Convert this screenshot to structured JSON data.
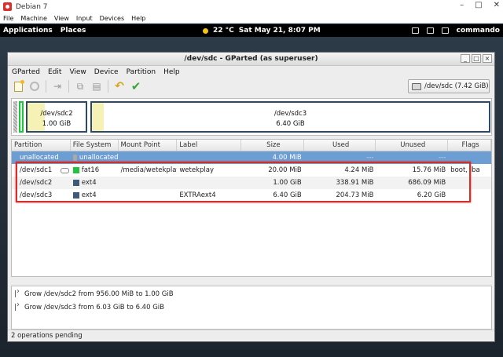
{
  "host": {
    "title": "Debian 7",
    "controls": [
      "–",
      "□",
      "✕"
    ],
    "menu": [
      "File",
      "Machine",
      "View",
      "Input",
      "Devices",
      "Help"
    ]
  },
  "panel": {
    "applications": "Applications",
    "places": "Places",
    "weather": "22 °C",
    "datetime": "Sat May 21,  8:07 PM",
    "user": "commando"
  },
  "gparted": {
    "title": "/dev/sdc - GParted (as superuser)",
    "window_controls": [
      "_",
      "□",
      "×"
    ],
    "menu": [
      "GParted",
      "Edit",
      "View",
      "Device",
      "Partition",
      "Help"
    ],
    "device_select": "/dev/sdc  (7.42 GiB)",
    "map": {
      "sdc2": {
        "name": "/dev/sdc2",
        "size": "1.00 GiB"
      },
      "sdc3": {
        "name": "/dev/sdc3",
        "size": "6.40 GiB"
      }
    },
    "columns": [
      "Partition",
      "File System",
      "Mount Point",
      "Label",
      "Size",
      "Used",
      "Unused",
      "Flags"
    ],
    "rows": [
      {
        "partition": "unallocated",
        "fs": "unallocated",
        "fs_color": "#a9a9a9",
        "mount": "",
        "label": "",
        "size": "4.00 MiB",
        "used": "---",
        "unused": "---",
        "flags": ""
      },
      {
        "partition": "/dev/sdc1",
        "fs": "fat16",
        "fs_color": "#1fc53d",
        "mount": "/media/wetekplay",
        "label": "wetekplay",
        "size": "20.00 MiB",
        "used": "4.24 MiB",
        "unused": "15.76 MiB",
        "flags": "boot, lba"
      },
      {
        "partition": "/dev/sdc2",
        "fs": "ext4",
        "fs_color": "#3d5a7a",
        "mount": "",
        "label": "",
        "size": "1.00 GiB",
        "used": "338.91 MiB",
        "unused": "686.09 MiB",
        "flags": ""
      },
      {
        "partition": "/dev/sdc3",
        "fs": "ext4",
        "fs_color": "#3d5a7a",
        "mount": "",
        "label": "EXTRAext4",
        "size": "6.40 GiB",
        "used": "204.73 MiB",
        "unused": "6.20 GiB",
        "flags": ""
      }
    ],
    "operations": [
      "Grow /dev/sdc2 from 956.00 MiB to 1.00 GiB",
      "Grow /dev/sdc3 from 6.03 GiB to 6.40 GiB"
    ],
    "status": "2 operations pending"
  }
}
